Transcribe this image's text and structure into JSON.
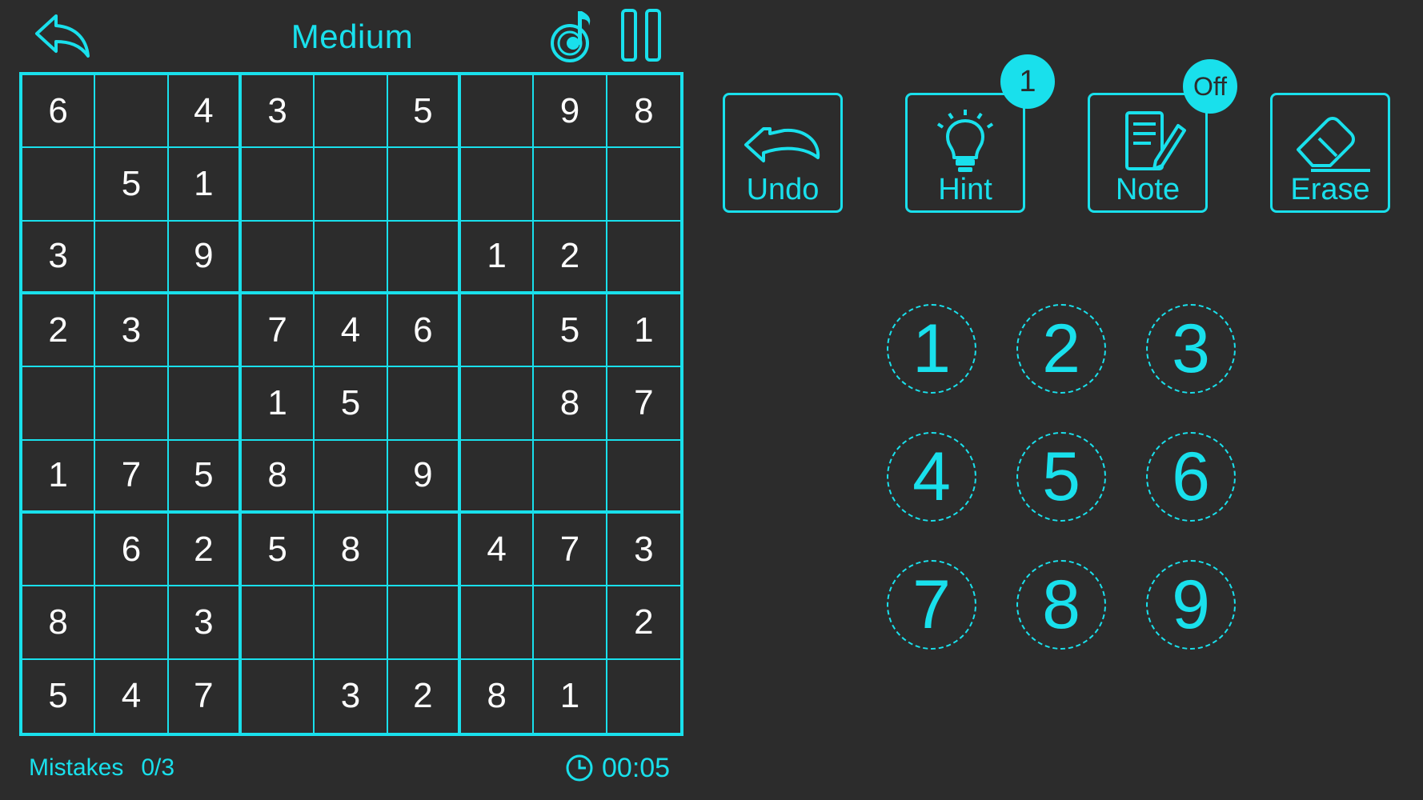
{
  "header": {
    "difficulty": "Medium"
  },
  "board": {
    "rows": [
      [
        "6",
        "",
        "4",
        "3",
        "",
        "5",
        "",
        "9",
        "8"
      ],
      [
        "",
        "5",
        "1",
        "",
        "",
        "",
        "",
        "",
        ""
      ],
      [
        "3",
        "",
        "9",
        "",
        "",
        "",
        "1",
        "2",
        ""
      ],
      [
        "2",
        "3",
        "",
        "7",
        "4",
        "6",
        "",
        "5",
        "1"
      ],
      [
        "",
        "",
        "",
        "1",
        "5",
        "",
        "",
        "8",
        "7"
      ],
      [
        "1",
        "7",
        "5",
        "8",
        "",
        "9",
        "",
        "",
        ""
      ],
      [
        "",
        "6",
        "2",
        "5",
        "8",
        "",
        "4",
        "7",
        "3"
      ],
      [
        "8",
        "",
        "3",
        "",
        "",
        "",
        "",
        "",
        "2"
      ],
      [
        "5",
        "4",
        "7",
        "",
        "3",
        "2",
        "8",
        "1",
        ""
      ]
    ]
  },
  "footer": {
    "mistakes_label": "Mistakes",
    "mistakes_value": "0/3",
    "timer": "00:05"
  },
  "tools": {
    "undo_label": "Undo",
    "hint_label": "Hint",
    "hint_count": "1",
    "note_label": "Note",
    "note_state": "Off",
    "erase_label": "Erase"
  },
  "numpad": [
    "1",
    "2",
    "3",
    "4",
    "5",
    "6",
    "7",
    "8",
    "9"
  ],
  "colors": {
    "accent": "#19e0ec",
    "background": "#2c2c2c",
    "digit": "#ffffff"
  },
  "icons": {
    "back": "back-arrow-icon",
    "music": "music-note-icon",
    "pause": "pause-icon",
    "clock": "clock-icon",
    "undo": "undo-arrow-icon",
    "hint": "lightbulb-icon",
    "note": "notepad-pencil-icon",
    "erase": "eraser-icon"
  }
}
